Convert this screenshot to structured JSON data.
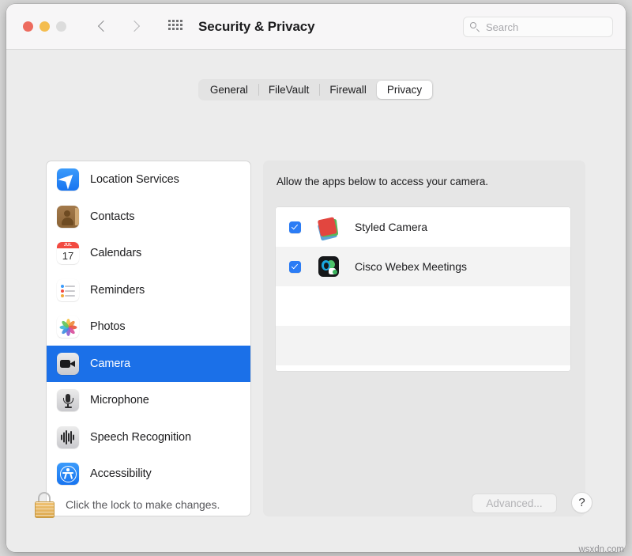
{
  "window": {
    "title": "Security & Privacy",
    "traffic_lights": [
      "close",
      "minimize",
      "zoom"
    ],
    "back_icon": "chevron-left-icon",
    "forward_icon": "chevron-right-icon",
    "grid_icon": "show-all-grid-icon"
  },
  "search": {
    "placeholder": "Search",
    "value": "",
    "icon": "search-icon"
  },
  "tabs": [
    {
      "label": "General",
      "selected": false
    },
    {
      "label": "FileVault",
      "selected": false
    },
    {
      "label": "Firewall",
      "selected": false
    },
    {
      "label": "Privacy",
      "selected": true
    }
  ],
  "sidebar": {
    "items": [
      {
        "label": "Location Services",
        "icon": "location-services-icon",
        "selected": false
      },
      {
        "label": "Contacts",
        "icon": "contacts-icon",
        "selected": false
      },
      {
        "label": "Calendars",
        "icon": "calendar-icon",
        "selected": false
      },
      {
        "label": "Reminders",
        "icon": "reminders-icon",
        "selected": false
      },
      {
        "label": "Photos",
        "icon": "photos-icon",
        "selected": false
      },
      {
        "label": "Camera",
        "icon": "camera-icon",
        "selected": true
      },
      {
        "label": "Microphone",
        "icon": "microphone-icon",
        "selected": false
      },
      {
        "label": "Speech Recognition",
        "icon": "speech-recognition-icon",
        "selected": false
      },
      {
        "label": "Accessibility",
        "icon": "accessibility-icon",
        "selected": false
      }
    ],
    "calendar_icon_month": "JUL",
    "calendar_icon_day": "17"
  },
  "detail": {
    "title": "Allow the apps below to access your camera.",
    "apps": [
      {
        "name": "Styled Camera",
        "checked": true,
        "icon": "styled-camera-app-icon"
      },
      {
        "name": "Cisco Webex Meetings",
        "checked": true,
        "icon": "cisco-webex-app-icon"
      }
    ]
  },
  "footer": {
    "lock_icon": "lock-closed-icon",
    "lock_message": "Click the lock to make changes.",
    "advanced_label": "Advanced...",
    "advanced_enabled": false,
    "help_label": "?"
  },
  "watermark": "wsxdn.com",
  "colors": {
    "accent": "#1b70e8",
    "checkbox": "#2b7cf5",
    "window_bg": "#ececec",
    "titlebar_bg": "#f7f6f7",
    "traffic_red": "#ed6b5e",
    "traffic_yellow": "#f4bd4f",
    "traffic_gray": "#dcdcdc",
    "lock_gold": "#dca94f"
  }
}
